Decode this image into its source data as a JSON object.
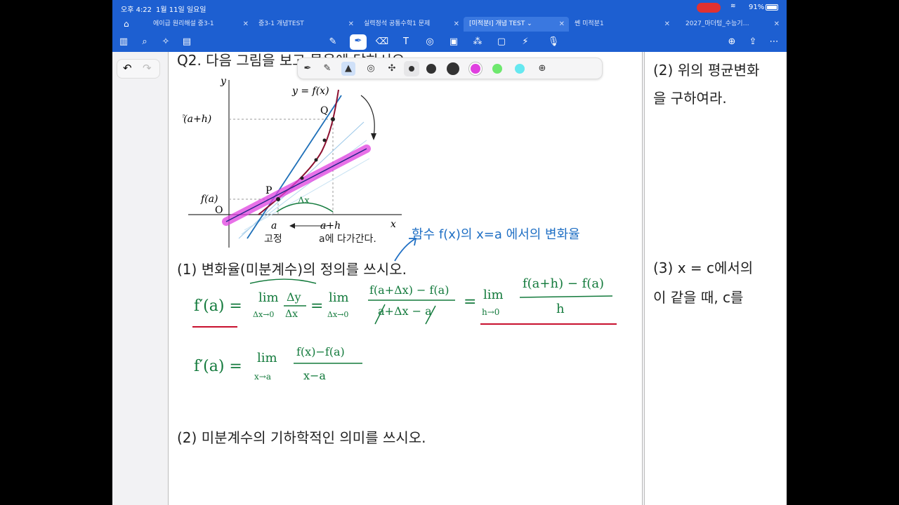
{
  "status": {
    "time": "오후 4:22",
    "date": "1월 11일 일요일",
    "battery": "91%"
  },
  "tabs": [
    {
      "label": "에이급 원리해설 중3-1"
    },
    {
      "label": "중3-1 개념TEST"
    },
    {
      "label": "실력정석 공통수학1 문제"
    },
    {
      "label": "[미적분I] 개념 TEST"
    },
    {
      "label": "쎈 미적분1"
    },
    {
      "label": "2027_마더텅_수능기…"
    }
  ],
  "doc": {
    "q2_title": "Q2. 다음 그림을 보고 물음에 답하시오.",
    "graph": {
      "y_axis": "y",
      "x_axis": "x",
      "curve_label": "y = f(x)",
      "point_q": "Q",
      "point_p": "P",
      "origin": "O",
      "fah": "f(a+h)",
      "fa": "f(a)",
      "a": "a",
      "ah": "a+h",
      "fixed": "고정",
      "approach": "a에 다가간다."
    },
    "hw_delta": "Δx",
    "hw_note": "함수 f(x)의 x=a 에서의 변화율",
    "q1": "(1) 변화율(미분계수)의 정의를 쓰시오.",
    "hw_line1": {
      "lhs": "f′(a) =",
      "lim1": "lim",
      "sub1": "Δx→0",
      "num1": "Δy",
      "den1": "Δx",
      "eq2": "=",
      "lim2": "lim",
      "sub2": "Δx→0",
      "num2": "f(a+Δx) − f(a)",
      "den2": "a+Δx − a",
      "eq3": "=",
      "lim3": "lim",
      "sub3": "h→0",
      "num3": "f(a+h) − f(a)",
      "den3": "h"
    },
    "hw_line2": {
      "lhs": "f′(a) =",
      "lim": "lim",
      "sub": "x→a",
      "num": "f(x)−f(a)",
      "den": "x−a"
    },
    "q2": "(2) 미분계수의 기하학적인 의미를 쓰시오."
  },
  "right_page": {
    "line1": "(2) 위의 평균변화",
    "line2": "을 구하여라.",
    "line3": "(3) x = c에서의",
    "line4": "이 같을 때, c를"
  },
  "colors": {
    "accent": "#1d5fd1",
    "green_ink": "#137a3c",
    "blue_ink": "#1f6fc4",
    "red_ink": "#c8102e",
    "highlighter": "#e040e0"
  }
}
